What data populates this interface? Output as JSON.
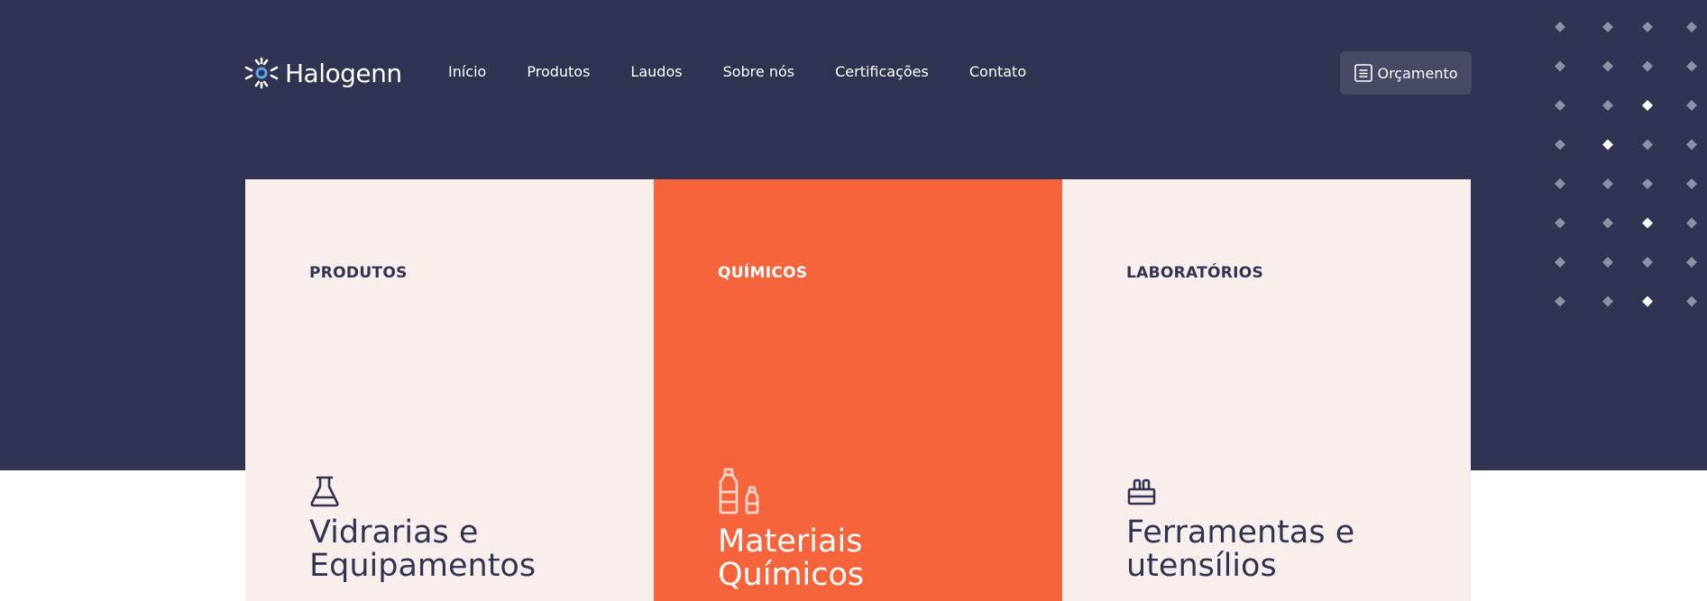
{
  "brand": {
    "name": "Halogenn",
    "logo_icon": "sparkle-logo-icon",
    "accent_color": "#f6643c",
    "dark_color": "#313352"
  },
  "nav": {
    "items": [
      "Início",
      "Produtos",
      "Laudos",
      "Sobre nós",
      "Certificações",
      "Contato"
    ]
  },
  "header": {
    "quote_button": {
      "label": "Orçamento",
      "icon": "document-list-icon"
    }
  },
  "cards": [
    {
      "category": "PRODUTOS",
      "title_line1": "Vidrarias e",
      "title_line2": "Equipamentos",
      "icon": "flask-icon"
    },
    {
      "category": "QUÍMICOS",
      "title_line1": "Materiais",
      "title_line2": "Químicos",
      "icon": "bottles-icon"
    },
    {
      "category": "LABORATÓRIOS",
      "title_line1": "Ferramentas e",
      "title_line2": "utensílios",
      "icon": "tube-rack-icon"
    }
  ]
}
